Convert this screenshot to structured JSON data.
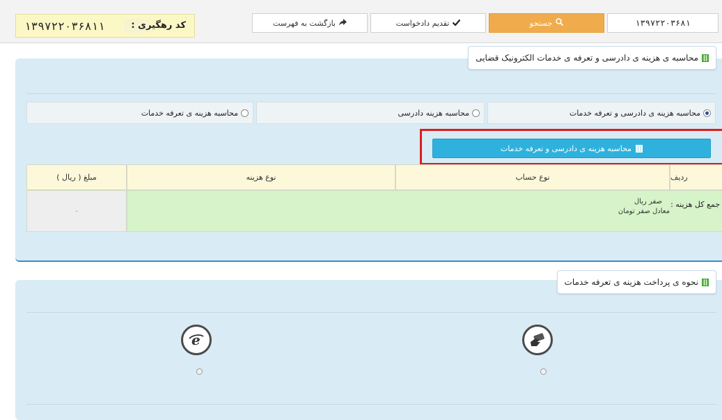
{
  "topbar": {
    "tracking_code": "۱۳۹۷۲۲۰۳۶۸۱۱",
    "tracking_label": "کد رهگیری :",
    "back_label": "بازگشت به فهرست",
    "submit_label": "تقدیم دادخواست",
    "search_label": "جستجو",
    "field_value": "۱۳۹۷۲۲۰۳۶۸۱"
  },
  "panel1": {
    "title": "محاسبه ی هزینه ی دادرسی و تعرفه ی خدمات الکترونیک قضایی",
    "options": [
      {
        "label": "محاسبه هزینه ی دادرسی و تعرفه خدمات",
        "selected": true
      },
      {
        "label": "محاسبه هزینه دادرسی",
        "selected": false
      },
      {
        "label": "محاسبه هزینه ی تعرفه خدمات",
        "selected": false
      }
    ],
    "calc_button": "محاسبه هزینه ی دادرسی و تعرفه خدمات",
    "table": {
      "headers": [
        "ردیف",
        "نوع حساب",
        "نوع هزینه",
        "مبلغ ( ریال )"
      ],
      "summary_label": "جمع کل هزینه :",
      "summary_rial": "صفر ریال",
      "summary_toman": "معادل صفر تومان",
      "amount": "۰"
    }
  },
  "panel2": {
    "title": "نحوه ی پرداخت هزینه ی تعرفه خدمات",
    "methods": [
      {
        "icon": "card-payment-icon",
        "selected": false
      },
      {
        "icon": "e-payment-icon",
        "selected": false
      }
    ]
  },
  "colors": {
    "accent_orange": "#f0ac4c",
    "accent_blue": "#2eb2dd",
    "panel_bg": "#d9ebf5",
    "highlight_red": "#e01c1c"
  }
}
